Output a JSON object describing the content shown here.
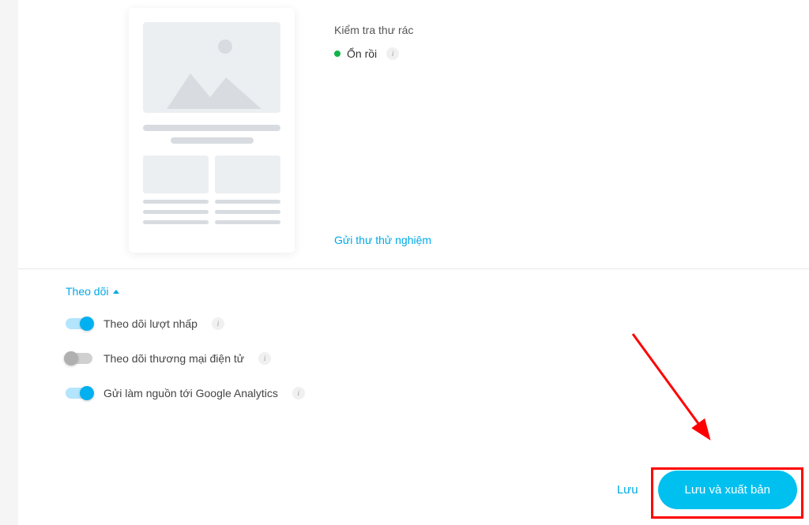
{
  "spam_check": {
    "label": "Kiểm tra thư rác",
    "status_text": "Ổn rồi"
  },
  "test_email_link": "Gửi thư thử nghiệm",
  "tracking": {
    "header": "Theo dõi",
    "options": [
      {
        "label": "Theo dõi lượt nhấp",
        "enabled": true
      },
      {
        "label": "Theo dõi thương mại điện tử",
        "enabled": false
      },
      {
        "label": "Gửi làm nguồn tới Google Analytics",
        "enabled": true
      }
    ]
  },
  "actions": {
    "save": "Lưu",
    "publish": "Lưu và xuất bản"
  }
}
